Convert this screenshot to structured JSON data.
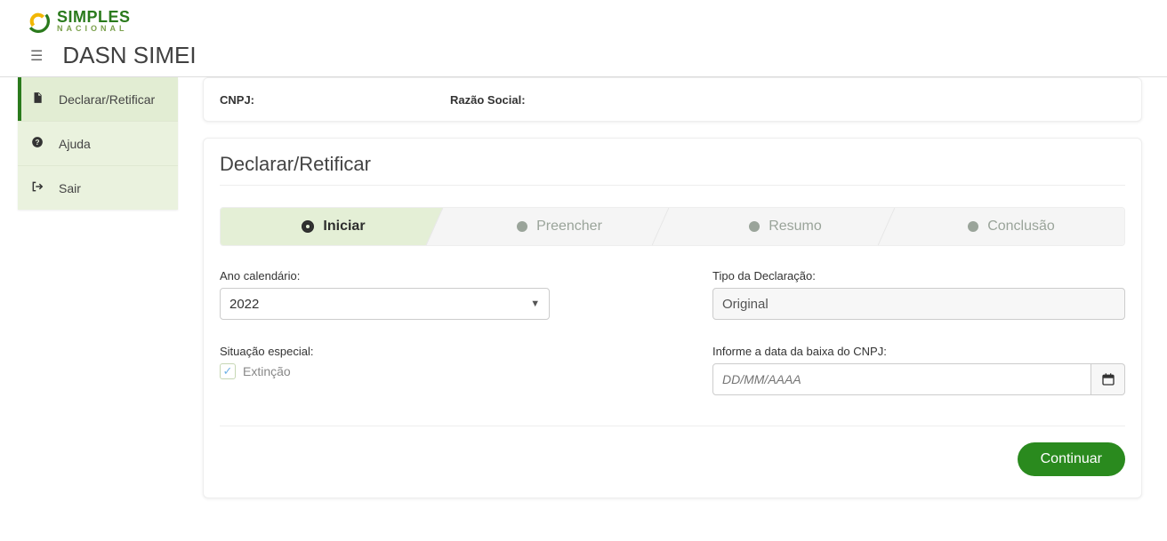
{
  "brand": {
    "line1": "SIMPLES",
    "line2": "NACIONAL"
  },
  "app_title": "DASN SIMEI",
  "sidebar": {
    "items": [
      {
        "label": "Declarar/Retificar",
        "icon": "file-icon",
        "active": true
      },
      {
        "label": "Ajuda",
        "icon": "help-icon",
        "active": false
      },
      {
        "label": "Sair",
        "icon": "signout-icon",
        "active": false
      }
    ]
  },
  "meta": {
    "cnpj_label": "CNPJ:",
    "cnpj_value": "",
    "razao_label": "Razão Social:",
    "razao_value": ""
  },
  "panel": {
    "title": "Declarar/Retificar",
    "steps": [
      {
        "label": "Iniciar",
        "active": true
      },
      {
        "label": "Preencher",
        "active": false
      },
      {
        "label": "Resumo",
        "active": false
      },
      {
        "label": "Conclusão",
        "active": false
      }
    ],
    "fields": {
      "ano_label": "Ano calendário:",
      "ano_value": "2022",
      "tipo_label": "Tipo da Declaração:",
      "tipo_value": "Original",
      "situacao_label": "Situação especial:",
      "situacao_option": "Extinção",
      "situacao_checked": true,
      "data_baixa_label": "Informe a data da baixa do CNPJ:",
      "data_baixa_placeholder": "DD/MM/AAAA",
      "data_baixa_value": ""
    },
    "continue_label": "Continuar"
  }
}
